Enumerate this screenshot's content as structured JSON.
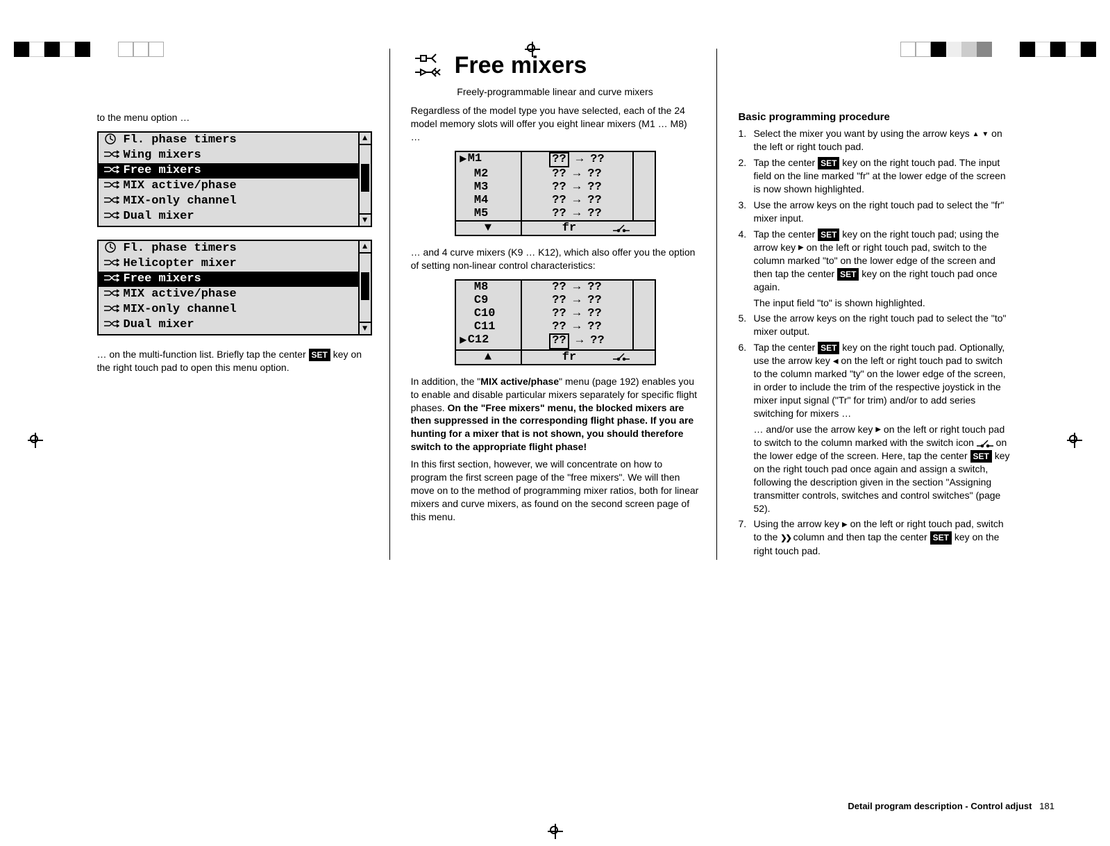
{
  "header": {
    "title": "Free mixers",
    "subtitle": "Freely-programmable linear and curve mixers"
  },
  "col1": {
    "lead_text": "to the menu option …",
    "menu1": {
      "items": [
        {
          "label": "Fl. phase timers",
          "icon": "clock",
          "selected": false
        },
        {
          "label": "Wing mixers",
          "icon": "mixer",
          "selected": false
        },
        {
          "label": "Free mixers",
          "icon": "mixer",
          "selected": true
        },
        {
          "label": "MIX active/phase",
          "icon": "mixer",
          "selected": false
        },
        {
          "label": "MIX-only channel",
          "icon": "mixer",
          "selected": false
        },
        {
          "label": "Dual mixer",
          "icon": "mixer",
          "selected": false
        }
      ]
    },
    "menu2": {
      "items": [
        {
          "label": "Fl. phase timers",
          "icon": "clock",
          "selected": false
        },
        {
          "label": "Helicopter mixer",
          "icon": "mixer",
          "selected": false
        },
        {
          "label": "Free mixers",
          "icon": "mixer",
          "selected": true
        },
        {
          "label": "MIX active/phase",
          "icon": "mixer",
          "selected": false
        },
        {
          "label": "MIX-only channel",
          "icon": "mixer",
          "selected": false
        },
        {
          "label": "Dual mixer",
          "icon": "mixer",
          "selected": false
        }
      ]
    },
    "outro_pre": "… on the multi-function list. Briefly tap the center ",
    "outro_key": "SET",
    "outro_post": " key on the right touch pad to open this menu option."
  },
  "col2": {
    "p1": "Regardless of the model type you have selected, each of the 24 model memory slots will offer you eight linear mixers (M1 … M8) …",
    "table1": {
      "rows": [
        {
          "name": "M1",
          "from": "??",
          "to": "??",
          "cursor": true,
          "boxed_from": true
        },
        {
          "name": "M2",
          "from": "??",
          "to": "??"
        },
        {
          "name": "M3",
          "from": "??",
          "to": "??"
        },
        {
          "name": "M4",
          "from": "??",
          "to": "??"
        },
        {
          "name": "M5",
          "from": "??",
          "to": "??"
        }
      ],
      "footer_label": "fr",
      "footer_arrow": "down"
    },
    "p2": "… and 4 curve mixers (K9 … K12), which also offer you the option of setting non-linear control characteristics:",
    "table2": {
      "rows": [
        {
          "name": "M8",
          "from": "??",
          "to": "??"
        },
        {
          "name": "C9",
          "from": "??",
          "to": "??"
        },
        {
          "name": "C10",
          "from": "??",
          "to": "??"
        },
        {
          "name": "C11",
          "from": "??",
          "to": "??"
        },
        {
          "name": "C12",
          "from": "??",
          "to": "??",
          "cursor": true,
          "boxed_from": true
        }
      ],
      "footer_label": "fr",
      "footer_arrow": "up"
    },
    "p3_pre": "In addition, the \"",
    "p3_bold1": "MIX active/phase",
    "p3_mid": "\" menu (page 192) enables you to enable and disable particular mixers separately for specific flight phases. ",
    "p3_bold2": "On the \"Free mixers\" menu, the blocked mixers are then suppressed in the corresponding flight phase. If you are hunting for a mixer that is not shown, you should therefore switch to the appropriate flight phase!",
    "p4": "In this first section, however, we will concentrate on how to program the first screen page of the \"free mixers\". We will then move on to the method of programming mixer ratios, both for linear mixers and curve mixers, as found on the second screen page of this menu."
  },
  "col3": {
    "heading": "Basic programming procedure",
    "steps": [
      {
        "parts": [
          {
            "t": "Select the mixer you want by using the arrow keys "
          },
          {
            "g": "tri-u"
          },
          {
            "t": " "
          },
          {
            "g": "tri-d"
          },
          {
            "t": " on the left or right touch pad."
          }
        ]
      },
      {
        "parts": [
          {
            "t": "Tap the center "
          },
          {
            "k": "SET"
          },
          {
            "t": " key on the right touch pad. The input field on the line marked \"fr\" at the lower edge of the screen is now shown highlighted."
          }
        ]
      },
      {
        "parts": [
          {
            "t": "Use the arrow keys on the right touch pad to select the \"fr\" mixer input."
          }
        ]
      },
      {
        "parts": [
          {
            "t": "Tap the center "
          },
          {
            "k": "SET"
          },
          {
            "t": " key on the right touch pad; using the arrow key "
          },
          {
            "g": "tri-r"
          },
          {
            "t": " on the left or right touch pad, switch to the column marked \"to\" on the lower edge of the screen and then tap the center "
          },
          {
            "k": "SET"
          },
          {
            "t": " key on the right touch pad once again."
          }
        ],
        "sub": "The input field \"to\" is shown highlighted."
      },
      {
        "parts": [
          {
            "t": "Use the arrow keys on the right touch pad to select the \"to\" mixer output."
          }
        ]
      },
      {
        "parts": [
          {
            "t": "Tap the center "
          },
          {
            "k": "SET"
          },
          {
            "t": " key on the right touch pad. Optionally, use the arrow key "
          },
          {
            "g": "tri-l"
          },
          {
            "t": " on the left or right touch pad to switch to the column marked \"ty\" on the lower edge of the screen, in order to include the trim of the respective joystick in the mixer input signal (\"Tr\" for trim) and/or to add series switching for mixers …"
          }
        ],
        "sub_parts": [
          {
            "t": "… and/or use the arrow key "
          },
          {
            "g": "tri-r"
          },
          {
            "t": " on the left or right touch pad to switch to the column marked with the switch icon "
          },
          {
            "g": "switch"
          },
          {
            "t": " on the lower edge of the screen. Here, tap the center "
          },
          {
            "k": "SET"
          },
          {
            "t": " key on the right touch pad once again and assign a switch, following the description given in the section \"Assigning transmitter controls, switches and control switches\" (page 52)."
          }
        ]
      },
      {
        "parts": [
          {
            "t": "Using the arrow key "
          },
          {
            "g": "tri-r"
          },
          {
            "t": " on the left or right touch pad, switch to the "
          },
          {
            "g": "dbl-arrow"
          },
          {
            "t": " column and then tap the center "
          },
          {
            "k": "SET"
          },
          {
            "t": " key on the right touch pad."
          }
        ]
      }
    ]
  },
  "footer": {
    "label": "Detail program description - Control adjust",
    "page": "181"
  }
}
